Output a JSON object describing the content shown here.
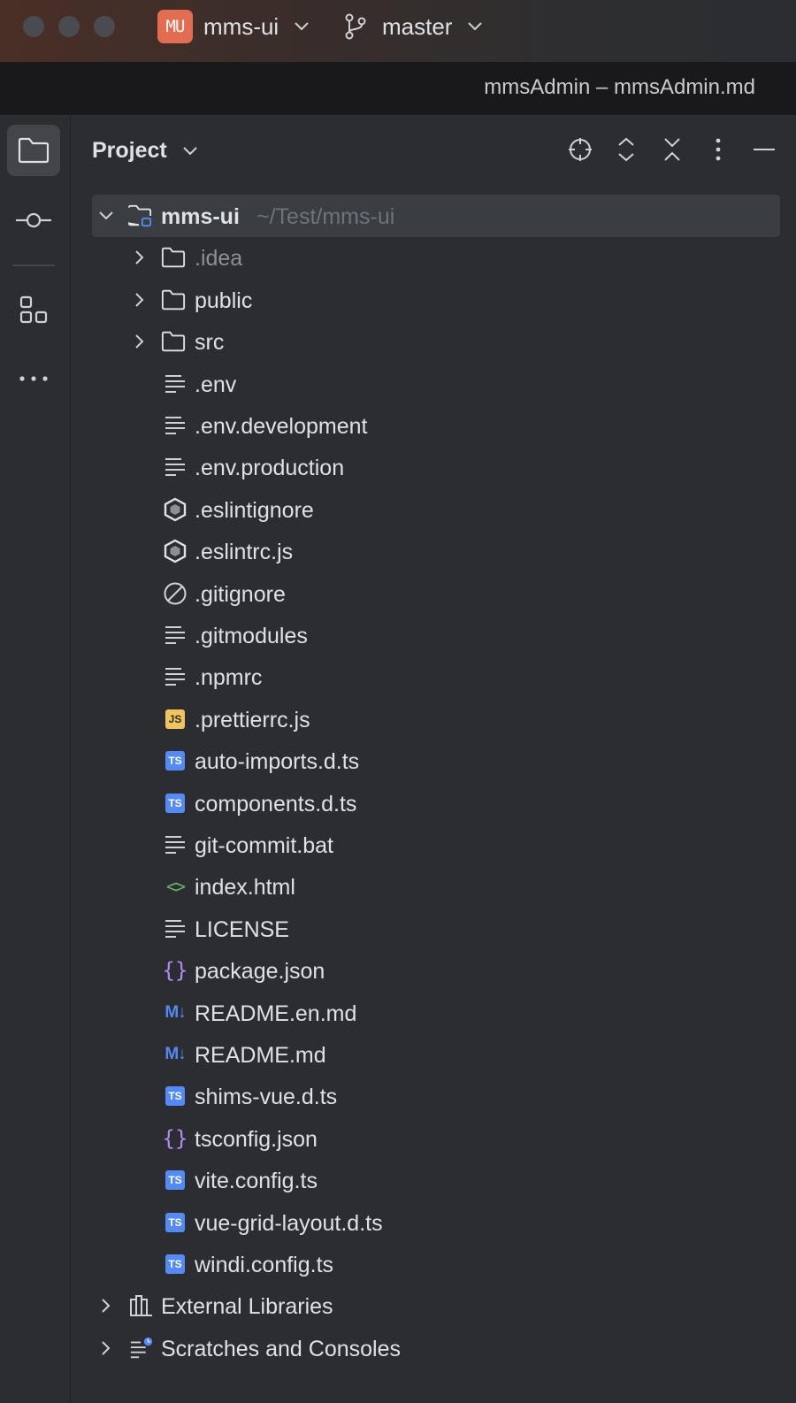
{
  "titlebar": {
    "project_badge": "MU",
    "project_name": "mms-ui",
    "branch_name": "master",
    "colors": {
      "badge": "#e26d50"
    }
  },
  "window_title": "mmsAdmin – mmsAdmin.md",
  "tool_stripe": {
    "buttons": [
      {
        "name": "project",
        "icon": "folder-icon",
        "active": true
      },
      {
        "name": "commit",
        "icon": "commit-icon",
        "active": false
      },
      {
        "name": "structure",
        "icon": "structure-icon",
        "active": false
      },
      {
        "name": "more",
        "icon": "more-horizontal-icon",
        "active": false
      }
    ]
  },
  "panel": {
    "title": "Project",
    "header_icons": [
      "locate-icon",
      "expand-all-icon",
      "collapse-all-icon",
      "options-icon",
      "hide-icon"
    ]
  },
  "tree": {
    "root": {
      "label": "mms-ui",
      "path_hint": "~/Test/mms-ui"
    },
    "folders": [
      {
        "label": ".idea",
        "dim": true
      },
      {
        "label": "public",
        "dim": false
      },
      {
        "label": "src",
        "dim": false
      }
    ],
    "files": [
      {
        "label": ".env",
        "icon": "text-file-icon"
      },
      {
        "label": ".env.development",
        "icon": "text-file-icon"
      },
      {
        "label": ".env.production",
        "icon": "text-file-icon"
      },
      {
        "label": ".eslintignore",
        "icon": "eslint-icon"
      },
      {
        "label": ".eslintrc.js",
        "icon": "eslint-icon"
      },
      {
        "label": ".gitignore",
        "icon": "ignore-file-icon"
      },
      {
        "label": ".gitmodules",
        "icon": "text-file-icon"
      },
      {
        "label": ".npmrc",
        "icon": "text-file-icon"
      },
      {
        "label": ".prettierrc.js",
        "icon": "javascript-file-icon",
        "badge": "JS"
      },
      {
        "label": "auto-imports.d.ts",
        "icon": "typescript-file-icon",
        "badge": "TS"
      },
      {
        "label": "components.d.ts",
        "icon": "typescript-file-icon",
        "badge": "TS"
      },
      {
        "label": "git-commit.bat",
        "icon": "text-file-icon"
      },
      {
        "label": "index.html",
        "icon": "html-file-icon",
        "badge": "<>"
      },
      {
        "label": "LICENSE",
        "icon": "text-file-icon"
      },
      {
        "label": "package.json",
        "icon": "json-file-icon",
        "badge": "{}"
      },
      {
        "label": "README.en.md",
        "icon": "markdown-file-icon",
        "badge": "M↓"
      },
      {
        "label": "README.md",
        "icon": "markdown-file-icon",
        "badge": "M↓"
      },
      {
        "label": "shims-vue.d.ts",
        "icon": "typescript-file-icon",
        "badge": "TS"
      },
      {
        "label": "tsconfig.json",
        "icon": "json-file-icon",
        "badge": "{}"
      },
      {
        "label": "vite.config.ts",
        "icon": "typescript-file-icon",
        "badge": "TS"
      },
      {
        "label": "vue-grid-layout.d.ts",
        "icon": "typescript-file-icon",
        "badge": "TS"
      },
      {
        "label": "windi.config.ts",
        "icon": "typescript-file-icon",
        "badge": "TS"
      }
    ],
    "bottom": [
      {
        "label": "External Libraries",
        "icon": "library-icon"
      },
      {
        "label": "Scratches and Consoles",
        "icon": "scratches-icon"
      }
    ]
  }
}
